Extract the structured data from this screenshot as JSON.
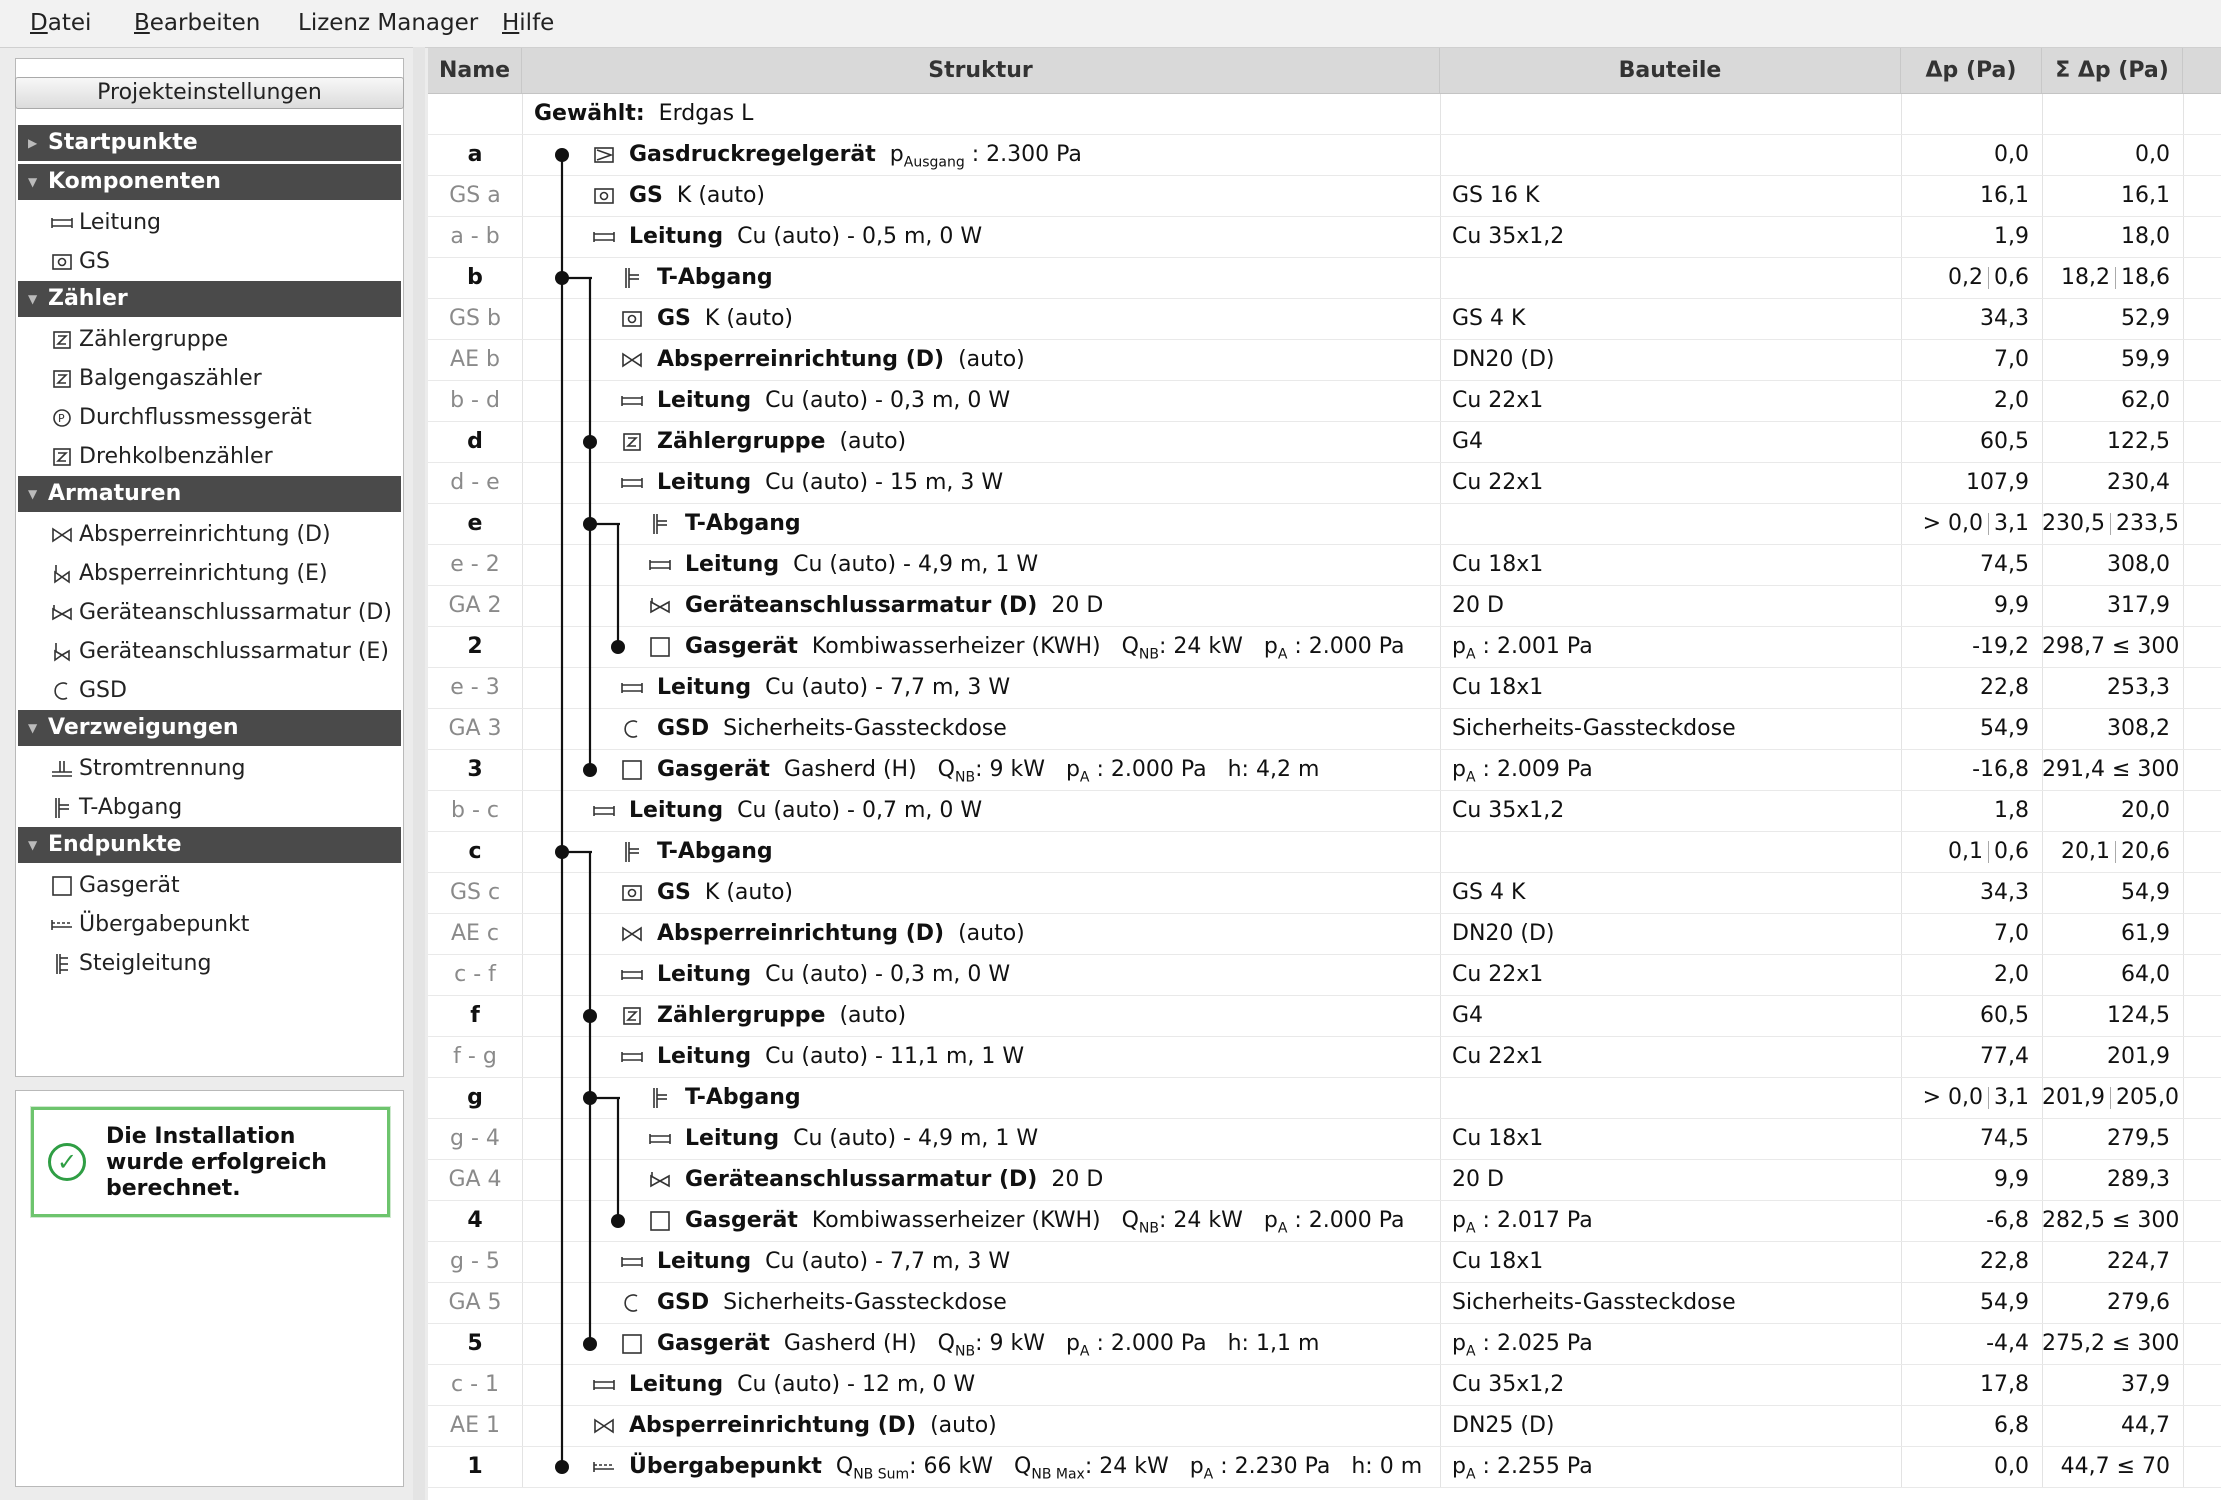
{
  "menu": [
    {
      "label": "Datei",
      "underline": "D",
      "rest": "atei"
    },
    {
      "label": "Bearbeiten",
      "underline": "B",
      "rest": "earbeiten"
    },
    {
      "label": "Lizenz Manager",
      "underline": "",
      "rest": "Lizenz Manager"
    },
    {
      "label": "Hilfe",
      "underline": "H",
      "rest": "ilfe"
    }
  ],
  "left": {
    "project_button": "Projekteinstellungen",
    "categories": [
      {
        "title": "Startpunkte",
        "items": []
      },
      {
        "title": "Komponenten",
        "items": [
          {
            "label": "Leitung",
            "icon": "pipe-icon"
          },
          {
            "label": "GS",
            "icon": "gas-pressure-regulator-icon"
          }
        ]
      },
      {
        "title": "Zähler",
        "items": [
          {
            "label": "Zählergruppe",
            "icon": "meter-z-icon"
          },
          {
            "label": "Balgengaszähler",
            "icon": "meter-z-icon"
          },
          {
            "label": "Durchflussmessgerät",
            "icon": "flow-meter-icon"
          },
          {
            "label": "Drehkolbenzähler",
            "icon": "meter-z-icon"
          }
        ]
      },
      {
        "title": "Armaturen",
        "items": [
          {
            "label": "Absperreinrichtung (D)",
            "icon": "valve-icon"
          },
          {
            "label": "Absperreinrichtung (E)",
            "icon": "valve-e-icon"
          },
          {
            "label": "Geräteanschlussarmatur (D)",
            "icon": "device-valve-icon"
          },
          {
            "label": "Geräteanschlussarmatur (E)",
            "icon": "device-valve-e-icon"
          },
          {
            "label": "GSD",
            "icon": "gsd-icon"
          }
        ]
      },
      {
        "title": "Verzweigungen",
        "items": [
          {
            "label": "Stromtrennung",
            "icon": "stream-split-icon"
          },
          {
            "label": "T-Abgang",
            "icon": "t-branch-icon"
          }
        ]
      },
      {
        "title": "Endpunkte",
        "items": [
          {
            "label": "Gasgerät",
            "icon": "gas-appliance-icon"
          },
          {
            "label": "Übergabepunkt",
            "icon": "transfer-point-icon"
          },
          {
            "label": "Steigleitung",
            "icon": "riser-icon"
          }
        ]
      }
    ],
    "status_message": "Die Installation wurde erfolgreich berechnet."
  },
  "table": {
    "headers": {
      "name": "Name",
      "struktur": "Struktur",
      "bauteile": "Bauteile",
      "dp": "Δp (Pa)",
      "sdp": "Σ Δp (Pa)"
    },
    "rows": [
      {
        "name": "",
        "nb": false,
        "lvl": 0,
        "icon": "",
        "type": "Gewählt:",
        "desc": "Erdgas L",
        "bau": "",
        "dp": "",
        "sdp": ""
      },
      {
        "name": "a",
        "nb": true,
        "lvl": 0,
        "icon": "regulator",
        "type": "Gasdruckregelgerät",
        "desc": "pAusgang : 2.300 Pa",
        "bau": "",
        "dp": "0,0",
        "sdp": "0,0"
      },
      {
        "name": "GS a",
        "nb": false,
        "lvl": 0,
        "icon": "gs",
        "type": "GS",
        "desc": "K (auto)",
        "bau": "GS 16 K",
        "dp": "16,1",
        "sdp": "16,1"
      },
      {
        "name": "a - b",
        "nb": false,
        "lvl": 0,
        "icon": "pipe",
        "type": "Leitung",
        "desc": "Cu (auto) - 0,5 m, 0 W",
        "bau": "Cu 35x1,2",
        "dp": "1,9",
        "sdp": "18,0"
      },
      {
        "name": "b",
        "nb": true,
        "lvl": 1,
        "icon": "tee",
        "type": "T-Abgang",
        "desc": "",
        "bau": "",
        "dp": "0,2|0,6",
        "sdp": "18,2|18,6"
      },
      {
        "name": "GS b",
        "nb": false,
        "lvl": 1,
        "icon": "gs",
        "type": "GS",
        "desc": "K (auto)",
        "bau": "GS 4 K",
        "dp": "34,3",
        "sdp": "52,9"
      },
      {
        "name": "AE b",
        "nb": false,
        "lvl": 1,
        "icon": "valve",
        "type": "Absperreinrichtung (D)",
        "desc": "(auto)",
        "bau": "DN20 (D)",
        "dp": "7,0",
        "sdp": "59,9"
      },
      {
        "name": "b - d",
        "nb": false,
        "lvl": 1,
        "icon": "pipe",
        "type": "Leitung",
        "desc": "Cu (auto) - 0,3 m, 0 W",
        "bau": "Cu 22x1",
        "dp": "2,0",
        "sdp": "62,0"
      },
      {
        "name": "d",
        "nb": true,
        "lvl": 1,
        "icon": "meter",
        "type": "Zählergruppe",
        "desc": "(auto)",
        "bau": "G4",
        "dp": "60,5",
        "sdp": "122,5"
      },
      {
        "name": "d - e",
        "nb": false,
        "lvl": 1,
        "icon": "pipe",
        "type": "Leitung",
        "desc": "Cu (auto) - 15 m, 3 W",
        "bau": "Cu 22x1",
        "dp": "107,9",
        "sdp": "230,4"
      },
      {
        "name": "e",
        "nb": true,
        "lvl": 2,
        "icon": "tee",
        "type": "T-Abgang",
        "desc": "",
        "bau": "",
        "dp": "> 0,0|3,1",
        "sdp": "230,5|233,5"
      },
      {
        "name": "e - 2",
        "nb": false,
        "lvl": 2,
        "icon": "pipe",
        "type": "Leitung",
        "desc": "Cu (auto) - 4,9 m, 1 W",
        "bau": "Cu 18x1",
        "dp": "74,5",
        "sdp": "308,0"
      },
      {
        "name": "GA 2",
        "nb": false,
        "lvl": 2,
        "icon": "devvalve",
        "type": "Geräteanschlussarmatur (D)",
        "desc": "20 D",
        "bau": "20 D",
        "dp": "9,9",
        "sdp": "317,9"
      },
      {
        "name": "2",
        "nb": true,
        "lvl": 2,
        "icon": "box",
        "type": "Gasgerät",
        "desc": "Kombiwasserheizer (KWH)   QNB: 24 kW   pA : 2.000 Pa",
        "bau": "pA : 2.001 Pa",
        "dp": "-19,2",
        "sdp": "298,7 ≤ 300"
      },
      {
        "name": "e - 3",
        "nb": false,
        "lvl": 1,
        "icon": "pipe",
        "type": "Leitung",
        "desc": "Cu (auto) - 7,7 m, 3 W",
        "bau": "Cu 18x1",
        "dp": "22,8",
        "sdp": "253,3"
      },
      {
        "name": "GA 3",
        "nb": false,
        "lvl": 1,
        "icon": "gsd",
        "type": "GSD",
        "desc": "Sicherheits-Gassteckdose",
        "bau": "Sicherheits-Gassteckdose",
        "dp": "54,9",
        "sdp": "308,2"
      },
      {
        "name": "3",
        "nb": true,
        "lvl": 1,
        "icon": "box",
        "type": "Gasgerät",
        "desc": "Gasherd (H)   QNB: 9 kW   pA : 2.000 Pa   h: 4,2 m",
        "bau": "pA : 2.009 Pa",
        "dp": "-16,8",
        "sdp": "291,4 ≤ 300"
      },
      {
        "name": "b - c",
        "nb": false,
        "lvl": 0,
        "icon": "pipe",
        "type": "Leitung",
        "desc": "Cu (auto) - 0,7 m, 0 W",
        "bau": "Cu 35x1,2",
        "dp": "1,8",
        "sdp": "20,0"
      },
      {
        "name": "c",
        "nb": true,
        "lvl": 1,
        "icon": "tee",
        "type": "T-Abgang",
        "desc": "",
        "bau": "",
        "dp": "0,1|0,6",
        "sdp": "20,1|20,6"
      },
      {
        "name": "GS c",
        "nb": false,
        "lvl": 1,
        "icon": "gs",
        "type": "GS",
        "desc": "K (auto)",
        "bau": "GS 4 K",
        "dp": "34,3",
        "sdp": "54,9"
      },
      {
        "name": "AE c",
        "nb": false,
        "lvl": 1,
        "icon": "valve",
        "type": "Absperreinrichtung (D)",
        "desc": "(auto)",
        "bau": "DN20 (D)",
        "dp": "7,0",
        "sdp": "61,9"
      },
      {
        "name": "c - f",
        "nb": false,
        "lvl": 1,
        "icon": "pipe",
        "type": "Leitung",
        "desc": "Cu (auto) - 0,3 m, 0 W",
        "bau": "Cu 22x1",
        "dp": "2,0",
        "sdp": "64,0"
      },
      {
        "name": "f",
        "nb": true,
        "lvl": 1,
        "icon": "meter",
        "type": "Zählergruppe",
        "desc": "(auto)",
        "bau": "G4",
        "dp": "60,5",
        "sdp": "124,5"
      },
      {
        "name": "f - g",
        "nb": false,
        "lvl": 1,
        "icon": "pipe",
        "type": "Leitung",
        "desc": "Cu (auto) - 11,1 m, 1 W",
        "bau": "Cu 22x1",
        "dp": "77,4",
        "sdp": "201,9"
      },
      {
        "name": "g",
        "nb": true,
        "lvl": 2,
        "icon": "tee",
        "type": "T-Abgang",
        "desc": "",
        "bau": "",
        "dp": "> 0,0|3,1",
        "sdp": "201,9|205,0"
      },
      {
        "name": "g - 4",
        "nb": false,
        "lvl": 2,
        "icon": "pipe",
        "type": "Leitung",
        "desc": "Cu (auto) - 4,9 m, 1 W",
        "bau": "Cu 18x1",
        "dp": "74,5",
        "sdp": "279,5"
      },
      {
        "name": "GA 4",
        "nb": false,
        "lvl": 2,
        "icon": "devvalve",
        "type": "Geräteanschlussarmatur (D)",
        "desc": "20 D",
        "bau": "20 D",
        "dp": "9,9",
        "sdp": "289,3"
      },
      {
        "name": "4",
        "nb": true,
        "lvl": 2,
        "icon": "box",
        "type": "Gasgerät",
        "desc": "Kombiwasserheizer (KWH)   QNB: 24 kW   pA : 2.000 Pa",
        "bau": "pA : 2.017 Pa",
        "dp": "-6,8",
        "sdp": "282,5 ≤ 300"
      },
      {
        "name": "g - 5",
        "nb": false,
        "lvl": 1,
        "icon": "pipe",
        "type": "Leitung",
        "desc": "Cu (auto) - 7,7 m, 3 W",
        "bau": "Cu 18x1",
        "dp": "22,8",
        "sdp": "224,7"
      },
      {
        "name": "GA 5",
        "nb": false,
        "lvl": 1,
        "icon": "gsd",
        "type": "GSD",
        "desc": "Sicherheits-Gassteckdose",
        "bau": "Sicherheits-Gassteckdose",
        "dp": "54,9",
        "sdp": "279,6"
      },
      {
        "name": "5",
        "nb": true,
        "lvl": 1,
        "icon": "box",
        "type": "Gasgerät",
        "desc": "Gasherd (H)   QNB: 9 kW   pA : 2.000 Pa   h: 1,1 m",
        "bau": "pA : 2.025 Pa",
        "dp": "-4,4",
        "sdp": "275,2 ≤ 300"
      },
      {
        "name": "c - 1",
        "nb": false,
        "lvl": 0,
        "icon": "pipe",
        "type": "Leitung",
        "desc": "Cu (auto) - 12 m, 0 W",
        "bau": "Cu 35x1,2",
        "dp": "17,8",
        "sdp": "37,9"
      },
      {
        "name": "AE 1",
        "nb": false,
        "lvl": 0,
        "icon": "valve",
        "type": "Absperreinrichtung (D)",
        "desc": "(auto)",
        "bau": "DN25 (D)",
        "dp": "6,8",
        "sdp": "44,7"
      },
      {
        "name": "1",
        "nb": true,
        "lvl": 0,
        "icon": "transfer",
        "type": "Übergabepunkt",
        "desc": "QNB Sum: 66 kW   QNB Max: 24 kW   pA : 2.230 Pa   h: 0 m",
        "bau": "pA : 2.255 Pa",
        "dp": "0,0",
        "sdp": "44,7 ≤ 70"
      }
    ]
  }
}
